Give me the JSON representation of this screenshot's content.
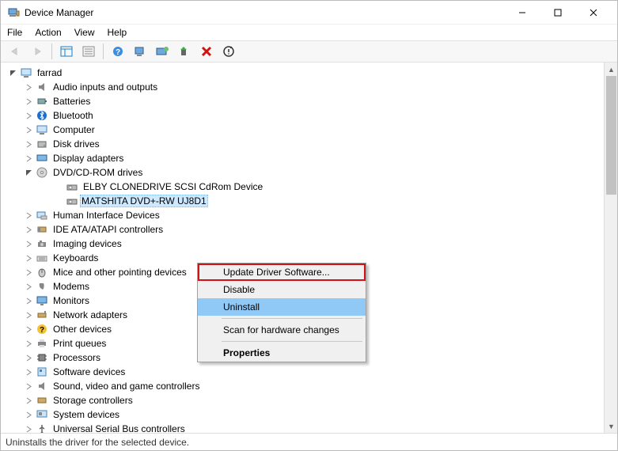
{
  "window": {
    "title": "Device Manager"
  },
  "menubar": {
    "file": "File",
    "action": "Action",
    "view": "View",
    "help": "Help"
  },
  "statusbar": {
    "text": "Uninstalls the driver for the selected device."
  },
  "tree": {
    "root": {
      "label": "farrad"
    },
    "items": [
      {
        "label": "Audio inputs and outputs"
      },
      {
        "label": "Batteries"
      },
      {
        "label": "Bluetooth"
      },
      {
        "label": "Computer"
      },
      {
        "label": "Disk drives"
      },
      {
        "label": "Display adapters"
      },
      {
        "label": "DVD/CD-ROM drives",
        "expanded": true,
        "children": [
          "ELBY CLONEDRIVE SCSI CdRom Device",
          "MATSHITA DVD+-RW UJ8D1"
        ]
      },
      {
        "label": "Human Interface Devices"
      },
      {
        "label": "IDE ATA/ATAPI controllers"
      },
      {
        "label": "Imaging devices"
      },
      {
        "label": "Keyboards"
      },
      {
        "label": "Mice and other pointing devices"
      },
      {
        "label": "Modems"
      },
      {
        "label": "Monitors"
      },
      {
        "label": "Network adapters"
      },
      {
        "label": "Other devices"
      },
      {
        "label": "Print queues"
      },
      {
        "label": "Processors"
      },
      {
        "label": "Software devices"
      },
      {
        "label": "Sound, video and game controllers"
      },
      {
        "label": "Storage controllers"
      },
      {
        "label": "System devices"
      },
      {
        "label": "Universal Serial Bus controllers"
      }
    ]
  },
  "context_menu": {
    "update": "Update Driver Software...",
    "disable": "Disable",
    "uninstall": "Uninstall",
    "scan": "Scan for hardware changes",
    "properties": "Properties"
  }
}
